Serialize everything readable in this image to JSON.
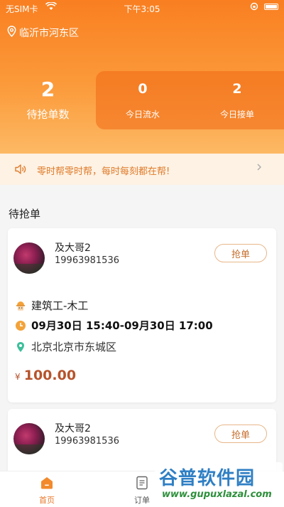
{
  "status_bar": {
    "carrier": "无SIM卡",
    "time": "下午3:05"
  },
  "location": {
    "city": "临沂市河东区"
  },
  "stats": {
    "pending": {
      "value": "2",
      "label": "待抢单数"
    },
    "today_flow": {
      "value": "0",
      "label": "今日流水"
    },
    "today_orders": {
      "value": "2",
      "label": "今日接单"
    }
  },
  "notice": {
    "text": "零时帮零时帮，每时每刻都在帮!"
  },
  "section_title": "待抢单",
  "orders": [
    {
      "name": "及大哥2",
      "phone": "19963981536",
      "button": "抢单",
      "job": "建筑工-木工",
      "time": "09月30日 15:40-09月30日 17:00",
      "address": "北京北京市东城区",
      "currency": "¥",
      "price": "100.00"
    },
    {
      "name": "及大哥2",
      "phone": "19963981536",
      "button": "抢单"
    }
  ],
  "tabbar": {
    "home": "首页",
    "orders": "订单"
  },
  "watermark": {
    "brand": "谷普软件园",
    "url": "www.gupuxlazal.com"
  },
  "colors": {
    "accent": "#f97f21",
    "price": "#b6532b",
    "notice_text": "#e07b2a"
  },
  "icons": [
    "location-pin-icon",
    "speaker-icon",
    "chevron-right-icon",
    "worker-icon",
    "clock-icon",
    "map-pin-icon",
    "home-icon",
    "document-icon",
    "wifi-icon",
    "battery-icon"
  ]
}
